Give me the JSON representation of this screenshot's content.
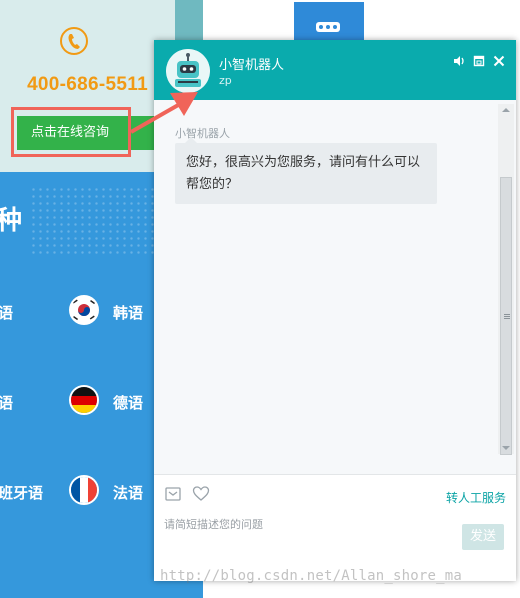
{
  "site": {
    "hotline": "400-686-5511",
    "consult_button": "点击在线咨询",
    "partial_heading": "种",
    "languages": [
      {
        "label": "语",
        "flag": ""
      },
      {
        "label": "韩语",
        "flag": "korea-flag-icon"
      },
      {
        "label": "语",
        "flag": ""
      },
      {
        "label": "德语",
        "flag": "germany-flag-icon"
      },
      {
        "label": "班牙语",
        "flag": ""
      },
      {
        "label": "法语",
        "flag": "france-flag-icon"
      }
    ],
    "colors": {
      "hotline": "#f19a14",
      "consult": "#33b24a",
      "blue": "#3598dc",
      "highlight": "#f06459"
    }
  },
  "chat": {
    "bot_name": "小智机器人",
    "bot_sub": "zp",
    "message_sender": "小智机器人",
    "message_text": "您好，很高兴为您服务，请问有什么可以帮您的？",
    "transfer_label": "转人工服务",
    "input_placeholder": "请简短描述您的问题",
    "send_label": "发送",
    "colors": {
      "header": "#0aabad",
      "bubble": "#e8ecef"
    },
    "header_icons": [
      "speaker-icon",
      "restore-window-icon",
      "close-icon"
    ],
    "tool_icons": [
      "screenshot-icon",
      "heart-icon"
    ]
  },
  "watermark": "http://blog.csdn.net/Allan_shore_ma"
}
